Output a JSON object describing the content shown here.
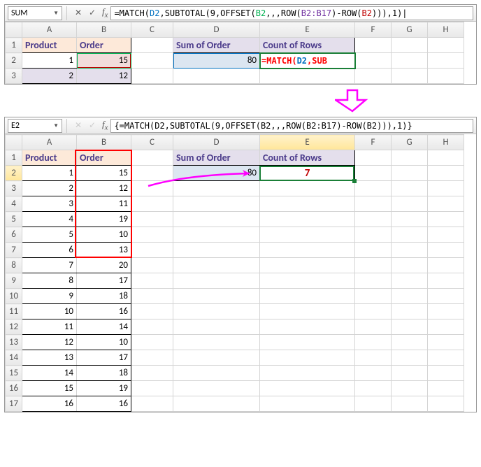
{
  "top": {
    "namebox": "SUM",
    "formula_html": "=MATCH(<span style='color:#0070c0'>D2</span>,SUBTOTAL(9,OFFSET(<span style='color:#00b050'>B2</span>,,,ROW(<span style='color:#7030a0'>B2:B17</span>)-ROW(<span style='color:#c00000'>B2</span>))),1)|",
    "cols": [
      "A",
      "B",
      "C",
      "D",
      "E",
      "F",
      "G",
      "H"
    ],
    "rows": [
      "1",
      "2",
      "3"
    ],
    "hdrA": "Product",
    "hdrB": "Order",
    "hdrD": "Sum of Order",
    "hdrE": "Count of Rows",
    "r2A": "1",
    "r2B": "15",
    "r2D": "80",
    "r2E_html": "<span style='color:#ff0000;font-weight:bold'>=MATCH(</span><span style='color:#0070c0;font-weight:bold'>D2</span><span style='color:#ff0000;font-weight:bold'>,SUB</span>",
    "r3A": "2",
    "r3B": "12"
  },
  "bottom": {
    "namebox": "E2",
    "formula": "{=MATCH(D2,SUBTOTAL(9,OFFSET(B2,,,ROW(B2:B17)-ROW(B2))),1)}",
    "cols": [
      "A",
      "B",
      "C",
      "D",
      "E",
      "F",
      "G",
      "H"
    ],
    "hdrA": "Product",
    "hdrB": "Order",
    "hdrD": "Sum of Order",
    "hdrE": "Count of Rows",
    "D2": "80",
    "E2": "7",
    "rows": [
      {
        "n": "1"
      },
      {
        "n": "2",
        "a": "1",
        "b": "15"
      },
      {
        "n": "3",
        "a": "2",
        "b": "12"
      },
      {
        "n": "4",
        "a": "3",
        "b": "11"
      },
      {
        "n": "5",
        "a": "4",
        "b": "19"
      },
      {
        "n": "6",
        "a": "5",
        "b": "10"
      },
      {
        "n": "7",
        "a": "6",
        "b": "13"
      },
      {
        "n": "8",
        "a": "7",
        "b": "20"
      },
      {
        "n": "9",
        "a": "8",
        "b": "17"
      },
      {
        "n": "10",
        "a": "9",
        "b": "18"
      },
      {
        "n": "11",
        "a": "10",
        "b": "16"
      },
      {
        "n": "12",
        "a": "11",
        "b": "14"
      },
      {
        "n": "13",
        "a": "12",
        "b": "10"
      },
      {
        "n": "14",
        "a": "13",
        "b": "17"
      },
      {
        "n": "15",
        "a": "14",
        "b": "18"
      },
      {
        "n": "16",
        "a": "15",
        "b": "19"
      },
      {
        "n": "17",
        "a": "16",
        "b": "16"
      }
    ]
  }
}
